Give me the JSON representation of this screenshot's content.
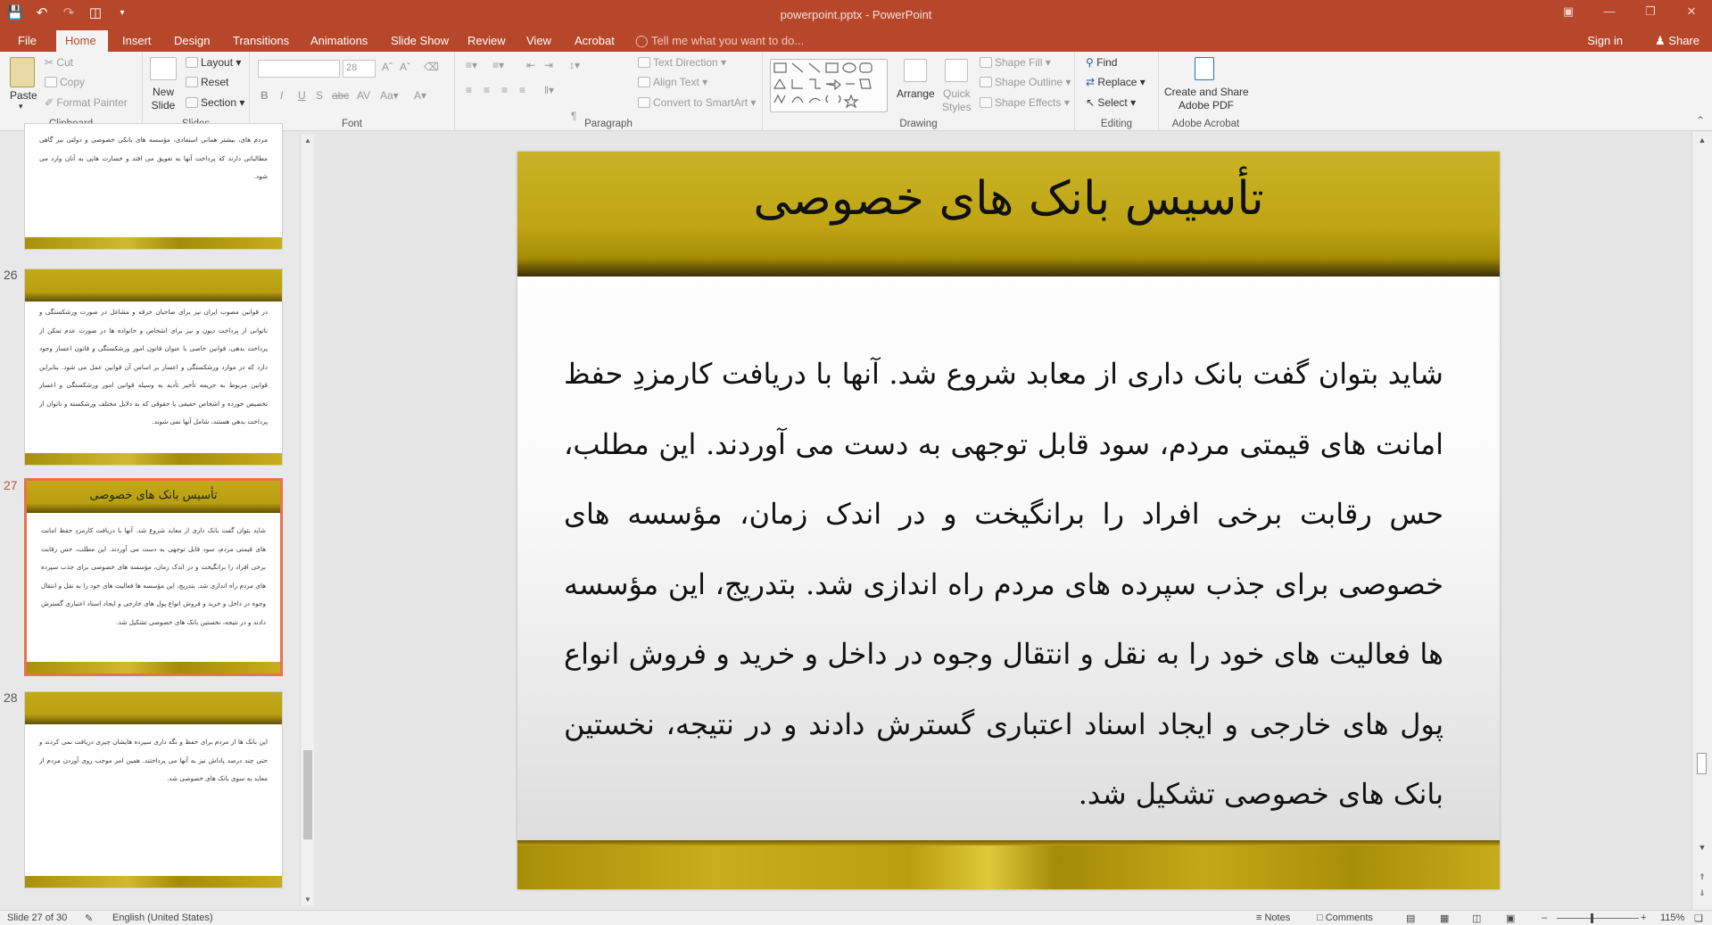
{
  "window": {
    "title": "powerpoint.pptx - PowerPoint"
  },
  "qat": {
    "save": "save-icon",
    "undo": "undo-icon",
    "redo": "redo-icon",
    "present": "present-icon",
    "customize": "customize-icon"
  },
  "tabs": [
    {
      "label": "File"
    },
    {
      "label": "Home"
    },
    {
      "label": "Insert"
    },
    {
      "label": "Design"
    },
    {
      "label": "Transitions"
    },
    {
      "label": "Animations"
    },
    {
      "label": "Slide Show"
    },
    {
      "label": "Review"
    },
    {
      "label": "View"
    },
    {
      "label": "Acrobat"
    }
  ],
  "tell_me": "Tell me what you want to do...",
  "sign_in": "Sign in",
  "share": "Share",
  "ribbon": {
    "clipboard": {
      "paste": "Paste",
      "cut": "Cut",
      "copy": "Copy",
      "format_painter": "Format Painter",
      "label": "Clipboard"
    },
    "slides": {
      "new_slide_1": "New",
      "new_slide_2": "Slide",
      "layout": "Layout",
      "reset": "Reset",
      "section": "Section",
      "label": "Slides"
    },
    "font": {
      "size": "28",
      "label": "Font"
    },
    "paragraph": {
      "text_direction": "Text Direction",
      "align_text": "Align Text",
      "smartart": "Convert to SmartArt",
      "label": "Paragraph"
    },
    "drawing": {
      "arrange": "Arrange",
      "quick_styles_1": "Quick",
      "quick_styles_2": "Styles",
      "shape_fill": "Shape Fill",
      "shape_outline": "Shape Outline",
      "shape_effects": "Shape Effects",
      "label": "Drawing"
    },
    "editing": {
      "find": "Find",
      "replace": "Replace",
      "select": "Select",
      "label": "Editing"
    },
    "acrobat": {
      "create_1": "Create and Share",
      "create_2": "Adobe PDF",
      "label": "Adobe Acrobat"
    }
  },
  "thumbnails": [
    {
      "number": "",
      "title": "",
      "text": "مردم های، بیشتر همانی استفادی، مؤسسه های بانکی خصوصی و دولتی نیز گاهی مطالباتی دارند که پرداخت آنها به تعویق می افتد و خسارت هایی به آنان وارد می شود."
    },
    {
      "number": "26",
      "title": "",
      "text": "در قوانین مصوب ایران نیز برای صاحبان حرفه و مشاغل در صورت ورشکستگی و ناتوانی از پرداخت دیون و نیز برای اشخاص و خانواده ها در صورت عدم تمکن از پرداخت بدهی، قوانین خاصی با عنوان قانون امور ورشکستگی و قانون اعسار وجود دارد که در موارد ورشکستگی و اعسار بر اساس آن قوانین عمل می شود. بنابراین قوانین مربوط به جریمه تأخیر تأدیه به وسیله قوانین امور ورشکستگی و اعسار تخصیص خورده و اشخاص حقیقی یا حقوقی که به دلایل مختلف ورشکسته و ناتوان از پرداخت بدهی هستند، شامل آنها نمی شوند."
    },
    {
      "number": "27",
      "title": "تأسیس بانک های خصوصی",
      "text": "شاید بتوان گفت بانک داری از معابد شروع شد. آنها با دریافت کارمزدِ حفظ امانت های قیمتی مردم، سود قابل توجهی به دست می آوردند. این مطلب، حس رقابت برخی افراد را برانگیخت و در اندک زمان، مؤسسه های خصوصی برای جذب سپرده های مردم راه اندازی شد. بتدریج، این مؤسسه ها فعالیت های خود را به نقل و انتقال وجوه در داخل و خرید و فروش انواع پول های خارجی و ایجاد اسناد اعتباری گسترش دادند و در نتیجه، نخستین بانک های خصوصی تشکیل شد."
    },
    {
      "number": "28",
      "title": "",
      "text": "این بانک ها از مردم برای حفظ و نگه داری سپرده هایشان چیزی دریافت نمی کردند و حتی چند درصد پاداش نیز به آنها می پرداختند. همین امر موجب روی آوردن مردم از معابد به سوی بانک های خصوصی شد."
    }
  ],
  "slide": {
    "title": "تأسیس بانک های خصوصی",
    "body": "شاید بتوان گفت بانک داری از معابد شروع شد. آنها با دریافت کارمزدِ حفظ امانت های قیمتی مردم، سود قابل توجهی به دست می آوردند. این مطلب، حس رقابت برخی افراد را برانگیخت و در اندک زمان، مؤسسه های خصوصی برای جذب سپرده های مردم راه اندازی شد. بتدریج، این مؤسسه ها فعالیت های خود را به نقل و انتقال وجوه در داخل و خرید و فروش انواع پول های خارجی و ایجاد اسناد اعتباری گسترش دادند و در نتیجه، نخستین بانک های خصوصی تشکیل شد."
  },
  "status": {
    "slide_of": "Slide 27 of 30",
    "language": "English (United States)",
    "notes": "Notes",
    "comments": "Comments",
    "zoom": "115%"
  },
  "colors": {
    "accent": "#b7472a",
    "selection": "#e8724a",
    "gold": "#bfa514"
  }
}
